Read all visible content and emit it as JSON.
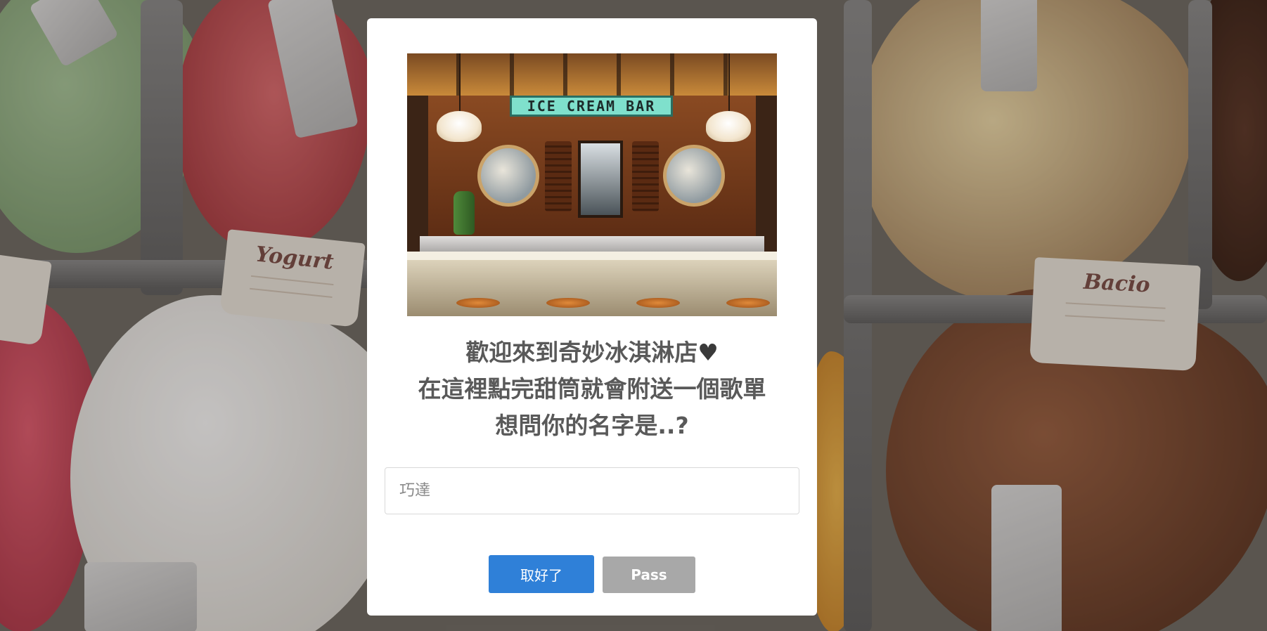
{
  "background": {
    "labels": [
      "Yogurt",
      "Bacio"
    ]
  },
  "modal": {
    "photo": {
      "sign_text": "ICE CREAM BAR"
    },
    "headline": {
      "line1": "歡迎來到奇妙冰淇淋店",
      "heart": "♥",
      "line2": "在這裡點完甜筒就會附送一個歌單",
      "line3": "想問你的名字是..?"
    },
    "name_input": {
      "value": "",
      "placeholder": "巧達"
    },
    "buttons": {
      "confirm_label": "取好了",
      "pass_label": "Pass"
    }
  },
  "colors": {
    "confirm_button": "#2f80d8",
    "pass_button": "#a8a8a8",
    "headline_text": "#595959"
  }
}
